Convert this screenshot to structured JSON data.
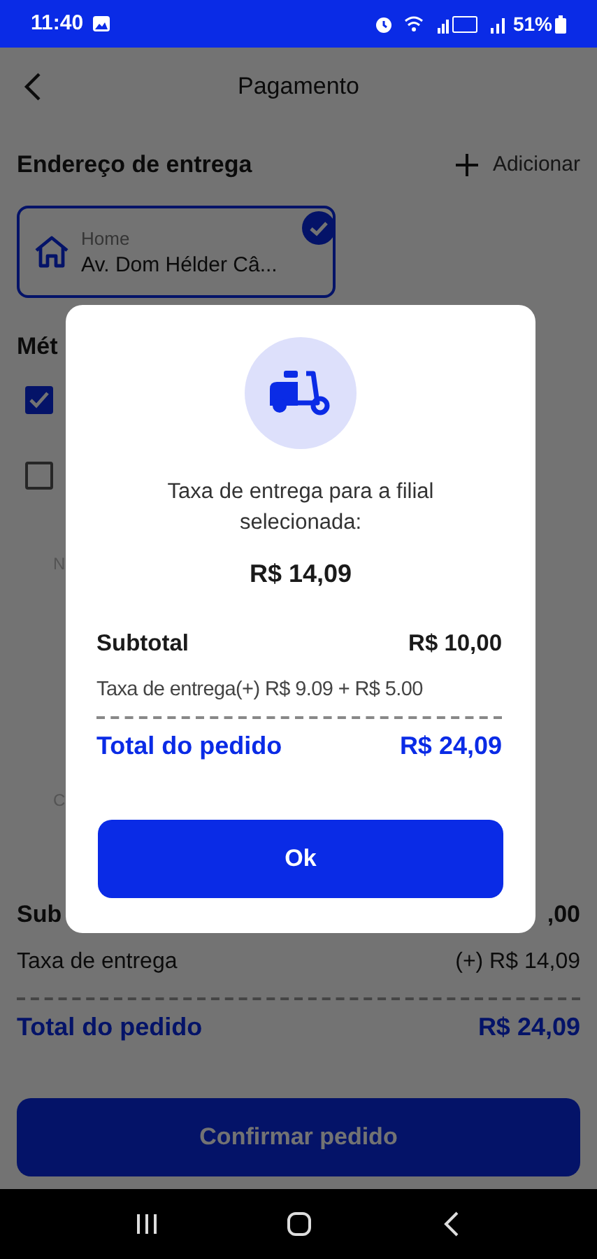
{
  "status_bar": {
    "time": "11:40",
    "battery": "51%"
  },
  "header": {
    "title": "Pagamento"
  },
  "address_section": {
    "title": "Endereço de entrega",
    "add_label": "Adicionar",
    "addresses": [
      {
        "label": "Home",
        "street": "Av. Dom Hélder Câ...",
        "selected": true
      }
    ]
  },
  "payment_section": {
    "title": "Mét",
    "options": [
      {
        "checked": true
      },
      {
        "checked": false
      }
    ],
    "hints": [
      "N",
      "C"
    ]
  },
  "summary": {
    "subtotal_label": "Sub",
    "subtotal_value": ",00",
    "fee_label": "Taxa de entrega",
    "fee_value": "(+) R$ 14,09",
    "total_label": "Total do pedido",
    "total_value": "R$ 24,09"
  },
  "confirm_button": "Confirmar pedido",
  "dialog": {
    "message": "Taxa de entrega para a filial selecionada:",
    "amount": "R$ 14,09",
    "rows": [
      {
        "kind": "pair",
        "label": "Subtotal",
        "value": "R$ 10,00"
      },
      {
        "kind": "line",
        "text": "Taxa de entrega(+) R$ 9.09 + R$ 5.00"
      },
      {
        "kind": "total",
        "label": "Total do pedido",
        "value": "R$ 24,09"
      }
    ],
    "button": "Ok"
  }
}
